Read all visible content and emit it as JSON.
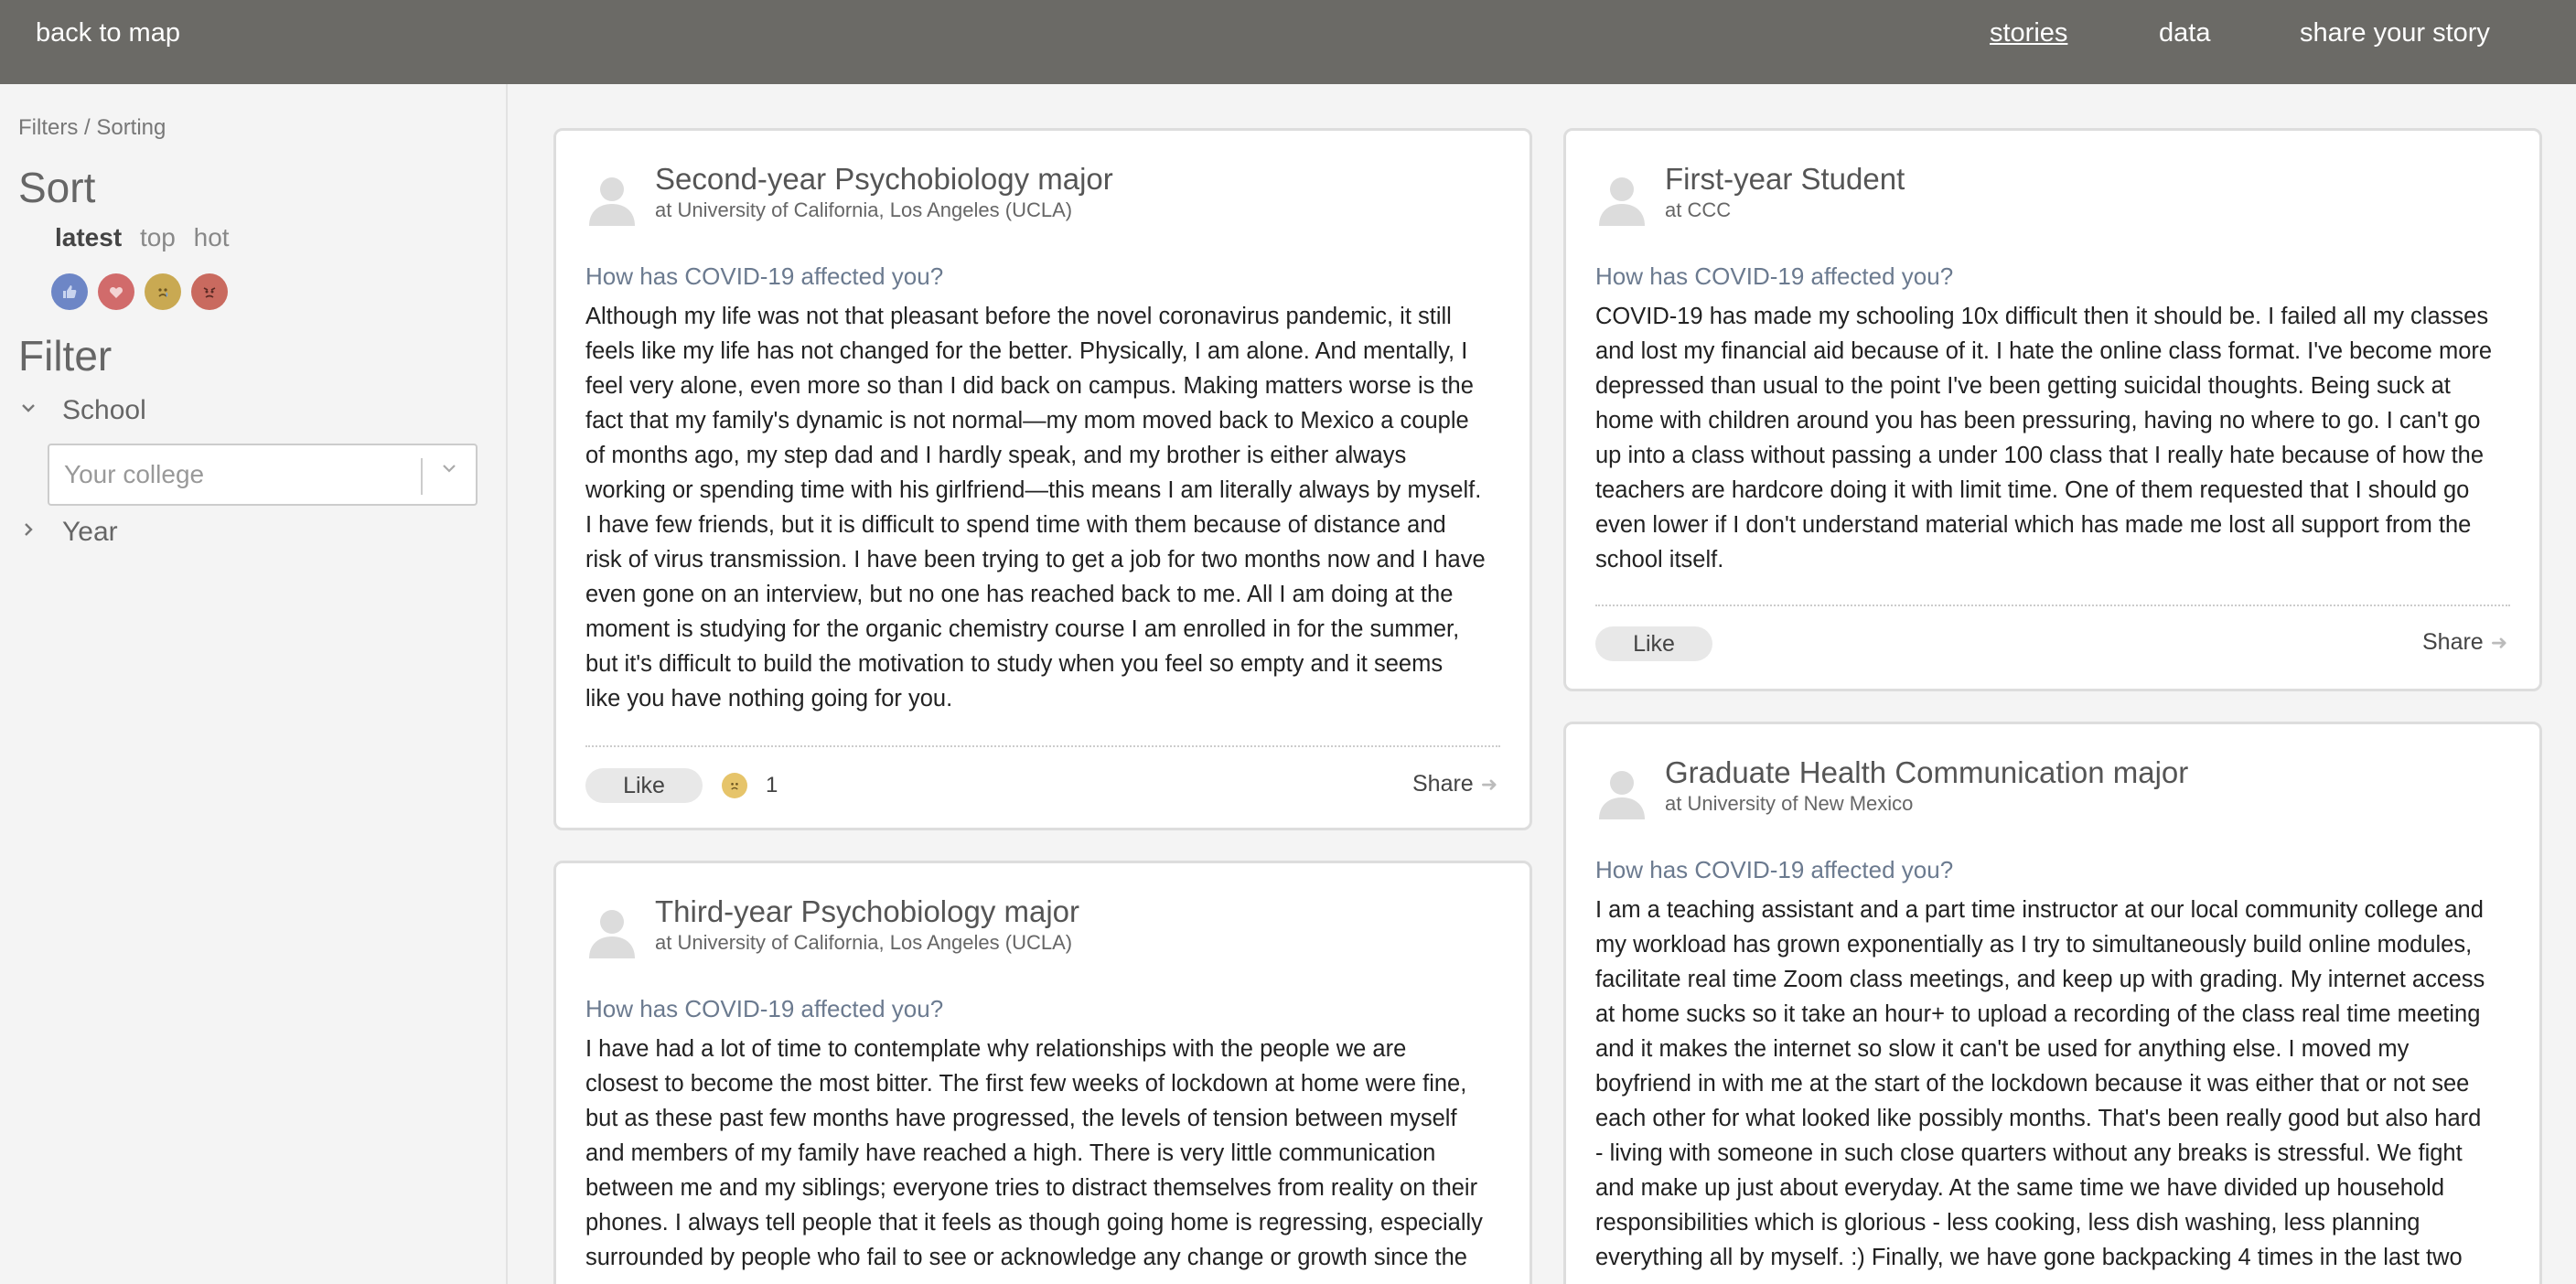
{
  "topbar": {
    "back_label": "back to map",
    "nav": [
      {
        "label": "stories",
        "active": true
      },
      {
        "label": "data",
        "active": false
      },
      {
        "label": "share your story",
        "active": false
      }
    ]
  },
  "sidebar": {
    "breadcrumb": "Filters / Sorting",
    "sort_heading": "Sort",
    "sort_options": [
      {
        "label": "latest",
        "active": true
      },
      {
        "label": "top",
        "active": false
      },
      {
        "label": "hot",
        "active": false
      }
    ],
    "reaction_filters": [
      {
        "name": "thumbs-up-icon",
        "color": "#6d86c6"
      },
      {
        "name": "heart-icon",
        "color": "#d16b6b"
      },
      {
        "name": "sad-face-icon",
        "color": "#c9a952"
      },
      {
        "name": "angry-face-icon",
        "color": "#c96a5f"
      }
    ],
    "filter_heading": "Filter",
    "school_label": "School",
    "school_placeholder": "Your college",
    "year_label": "Year"
  },
  "stories": [
    {
      "title": "Second-year Psychobiology major",
      "school": "at University of California, Los Angeles (UCLA)",
      "question": "How has COVID-19 affected you?",
      "body": [
        "Although my life was not that pleasant before the novel coronavirus pandemic, it still",
        "feels like my life has not changed for the better. Physically, I am alone. And mentally, I",
        "feel very alone, even more so than I did back on campus. Making matters worse is the",
        "fact that my family's dynamic is not normal—my mom moved back to Mexico a couple",
        "of months ago, my step dad and I hardly speak, and my brother is either always",
        "working or spending time with his girlfriend—this means I am literally always by myself.",
        "I have few friends, but it is difficult to spend time with them because of distance and",
        "risk of virus transmission. I have been trying to get a job for two months now and I have",
        "even gone on an interview, but no one has reached back to me. All I am doing at the",
        "moment is studying for the organic chemistry course I am enrolled in for the summer,",
        "but it's difficult to build the motivation to study when you feel so empty and it seems",
        "like you have nothing going for you."
      ],
      "like_label": "Like",
      "reaction_count": "1",
      "share_label": "Share"
    },
    {
      "title": "First-year Student",
      "school": "at CCC",
      "question": "How has COVID-19 affected you?",
      "body": [
        "COVID-19 has made my schooling 10x difficult then it should be. I failed all my classes",
        "and lost my financial aid because of it. I hate the online class format. I've become more",
        "depressed than usual to the point I've been getting suicidal thoughts. Being suck at",
        "home with children around you has been pressuring, having no where to go. I can't go",
        "up into a class without passing a under 100 class that I really hate because of how the",
        "teachers are hardcore doing it with limit time. One of them requested that I should go",
        "even lower if I don't understand material which has made me lost all support from the",
        "school itself."
      ],
      "like_label": "Like",
      "share_label": "Share"
    },
    {
      "title": "Third-year Psychobiology major",
      "school": "at University of California, Los Angeles (UCLA)",
      "question": "How has COVID-19 affected you?",
      "body": [
        "I have had a lot of time to contemplate why relationships with the people we are",
        "closest to become the most bitter. The first few weeks of lockdown at home were fine,",
        "but as these past few months have progressed, the levels of tension between myself",
        "and members of my family have reached a high. There is very little communication",
        "between me and my siblings; everyone tries to distract themselves from reality on their",
        "phones. I always tell people that it feels as though going home is regressing, especially",
        "surrounded by people who fail to see or acknowledge any change or growth since the"
      ]
    },
    {
      "title": "Graduate Health Communication major",
      "school": "at University of New Mexico",
      "question": "How has COVID-19 affected you?",
      "body": [
        "I am a teaching assistant and a part time instructor at our local community college and",
        "my workload has grown exponentially as I try to simultaneously build online modules,",
        "facilitate real time Zoom class meetings, and keep up with grading. My internet access",
        "at home sucks so it take an hour+ to upload a recording of the class real time meeting",
        "and it makes the internet so slow it can't be used for anything else. I moved my",
        "boyfriend in with me at the start of the lockdown because it was either that or not see",
        "each other for what looked like possibly months. That's been really good but also hard",
        "- living with someone in such close quarters without any breaks is stressful. We fight",
        "and make up just about everyday. At the same time we have divided up household",
        "responsibilities which is glorious - less cooking, less dish washing, less planning",
        "everything all by myself. :) Finally, we have gone backpacking 4 times in the last two"
      ]
    }
  ]
}
